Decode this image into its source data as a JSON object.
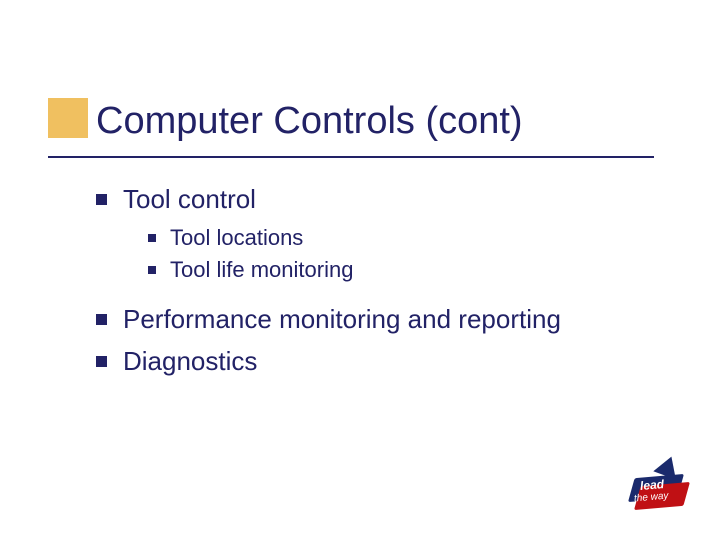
{
  "title": "Computer Controls (cont)",
  "bullets": {
    "b0": "Tool control",
    "b0_sub0": "Tool locations",
    "b0_sub1": "Tool life monitoring",
    "b1": "Performance monitoring and reporting",
    "b2": "Diagnostics"
  },
  "logo": {
    "line1": "lead",
    "line2": "the way"
  }
}
